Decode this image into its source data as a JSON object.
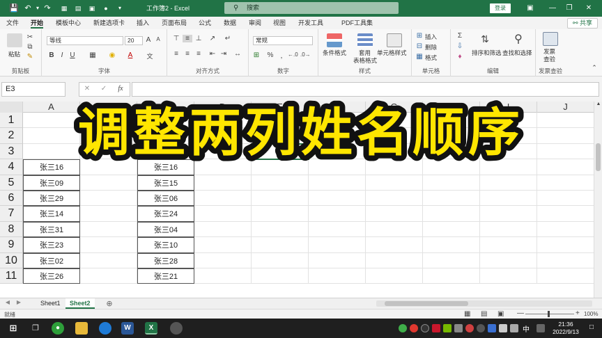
{
  "titlebar": {
    "title": "工作簿2 - Excel",
    "search_placeholder": "搜索",
    "login_label": "登录"
  },
  "tabs": [
    "文件",
    "开始",
    "模板中心",
    "新建选项卡",
    "插入",
    "页面布局",
    "公式",
    "数据",
    "审阅",
    "视图",
    "开发工具",
    "PDF工具集"
  ],
  "active_tab": "开始",
  "share_label": "共享",
  "ribbon": {
    "clipboard": {
      "label": "剪贴板",
      "paste": "粘贴"
    },
    "font": {
      "label": "字体",
      "font_name": "等线",
      "font_size": "20"
    },
    "alignment": {
      "label": "对齐方式"
    },
    "number": {
      "label": "数字",
      "format": "常规"
    },
    "styles": {
      "label": "样式",
      "conditional": "条件格式",
      "table1": "套用",
      "table2": "表格格式",
      "cell_styles": "单元格样式"
    },
    "cells": {
      "label": "单元格",
      "insert": "插入",
      "delete": "删除",
      "format": "格式"
    },
    "editing": {
      "label": "编辑",
      "sort": "排序和筛选",
      "find": "查找和选择"
    },
    "invoice": {
      "label": "发票查验",
      "btn1": "发票",
      "btn2": "查验"
    }
  },
  "formula_bar": {
    "name_box": "E3",
    "fx": "fx"
  },
  "grid": {
    "columns": [
      "A",
      "B",
      "C",
      "D",
      "E",
      "F",
      "G",
      "H",
      "I",
      "J"
    ],
    "rows": [
      "1",
      "2",
      "3",
      "4",
      "5",
      "6",
      "7",
      "8",
      "9",
      "10",
      "11"
    ],
    "col_a": [
      "张三16",
      "张三09",
      "张三29",
      "张三14",
      "张三31",
      "张三23",
      "张三02",
      "张三26"
    ],
    "col_c": [
      "张三16",
      "张三15",
      "张三06",
      "张三24",
      "张三04",
      "张三10",
      "张三28",
      "张三21"
    ]
  },
  "banner_text": "调整两列姓名顺序",
  "sheets": [
    "Sheet1",
    "Sheet2"
  ],
  "active_sheet": "Sheet2",
  "status": {
    "ready": "就绪",
    "zoom": "100%"
  },
  "taskbar": {
    "time": "21:36",
    "date": "2022/9/13",
    "ime": "中"
  },
  "colors": {
    "excel_green": "#217346",
    "banner_fill": "#ffe600",
    "banner_stroke": "#111111"
  }
}
